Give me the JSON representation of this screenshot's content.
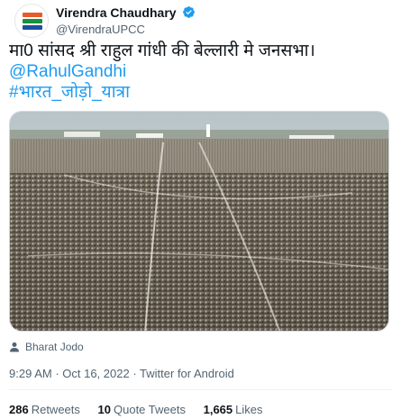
{
  "user": {
    "display_name": "Virendra Chaudhary",
    "handle": "@VirendraUPCC",
    "avatar_text": "भारत जोड़ो यात्रा"
  },
  "tweet": {
    "text_line1": "मा0 सांसद श्री राहुल गांधी की बेल्लारी मे जनसभा।",
    "mention": "@RahulGandhi",
    "hashtag": "#भारत_जोड़ो_यात्रा"
  },
  "media": {
    "caption": "Bharat Jodo"
  },
  "meta": {
    "time": "9:29 AM",
    "separator": " · ",
    "date": "Oct 16, 2022",
    "source": "Twitter for Android"
  },
  "stats": {
    "retweets_count": "286",
    "retweets_label": "Retweets",
    "quote_count": "10",
    "quote_label": "Quote Tweets",
    "likes_count": "1,665",
    "likes_label": "Likes"
  },
  "colors": {
    "link": "#1d9bf0",
    "secondary": "#536471",
    "primary": "#0f1419",
    "verified": "#1d9bf0"
  }
}
